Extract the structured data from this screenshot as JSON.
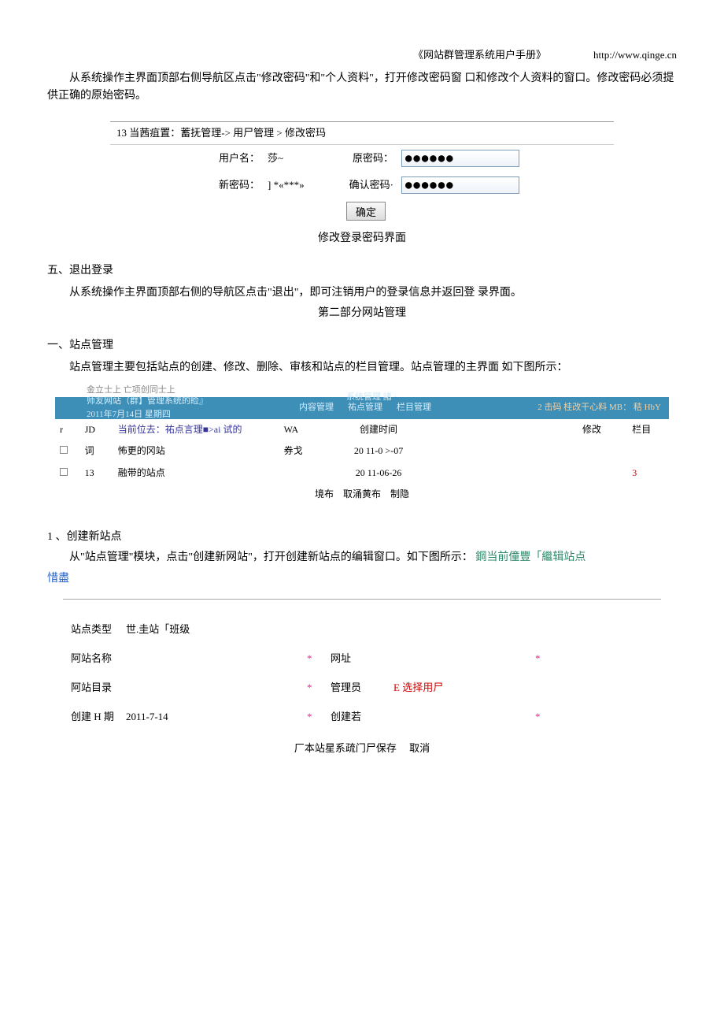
{
  "header": {
    "doc_title": "《网站群管理系统用户手册》",
    "url": "http://www.qinge.cn"
  },
  "intro_para": "从系统操作主界面顶部右侧导航区点击\"修改密码\"和\"个人资料\"，打开修改密码窗 口和修改个人资料的窗口。修改密码必须提供正确的原始密码。",
  "pw_form": {
    "breadcrumb": "13 当茜疽置：蓄抚管理-> 用尸管理 > 修改密玛",
    "user_label": "用户名：",
    "user_val": "莎~",
    "old_label": "原密码：",
    "old_val": "●●●●●●",
    "new_label": "新密码：",
    "new_val": "] *«***»",
    "confirm_label": "确认密码·",
    "confirm_val": "●●●●●●",
    "submit": "确定",
    "caption": "修改登录密码界面"
  },
  "sec5": {
    "title": "五、退出登录",
    "body": "从系统操作主界面顶部右侧的导航区点击\"退出\"，即可注销用户的登录信息并返回登 录界面。"
  },
  "part2_title": "第二部分网站管理",
  "sec_site": {
    "title": "一、站点管理",
    "body": "站点管理主要包括站点的创建、修改、删除、审核和站点的栏目管理。站点管理的主界面 如下图所示："
  },
  "site_ui": {
    "top_scribble": "金立士上 亡项创同士上",
    "banner_left1": "师友网站（群】管理系统的睑』",
    "banner_left2": "2011年7月14日 星期四",
    "mid1": "内容管理",
    "mid2": "祐点管理",
    "mid3": "栏目管理",
    "mid_head": "系统管理 諸 ·",
    "right": "2 击码 桂改干心料 MB： 秸 HbY",
    "cols": {
      "c_r": "r",
      "c_jd": "JD",
      "c_loc": "当前位去：祐点言理■>ai 试的",
      "c_wa": "WA",
      "c_time": "创建时间",
      "c_mod": "修改",
      "c_col": "栏目"
    },
    "rows": [
      {
        "a": "厂",
        "b": "词",
        "c": "怖更的冈站",
        "d": "券戈",
        "e": "20 11-0 >-07",
        "f": "",
        "g": ""
      },
      {
        "a": "厂",
        "b": "13",
        "c": "融带的站点",
        "d": "",
        "e": "20 11-06-26",
        "f": "",
        "g": "3"
      }
    ],
    "ops": "境布　取涌黄布　制隐"
  },
  "sub1": {
    "title": "1 、创建新站点",
    "body_pre": "从\"站点管理\"模块，点击\"创建新网站\"，打开创建新站点的编辑窗口。如下图所示：",
    "link1": "鋼当前僮豐「繼辑站点",
    "link2": "惜盡"
  },
  "create_form": {
    "type_label": "站点类型",
    "type_val": "世.圭站「班级",
    "name_label": "阿站名称",
    "url_label": "网址",
    "dir_label": "阿站目录",
    "admin_label": "管理员",
    "admin_val": "E 选择用尸",
    "date_label": "创建 H 期",
    "date_val": "2011-7-14",
    "creator_label": "创建若",
    "star": "*",
    "save": "厂本站星系疏门尸保存",
    "cancel": "取消"
  }
}
